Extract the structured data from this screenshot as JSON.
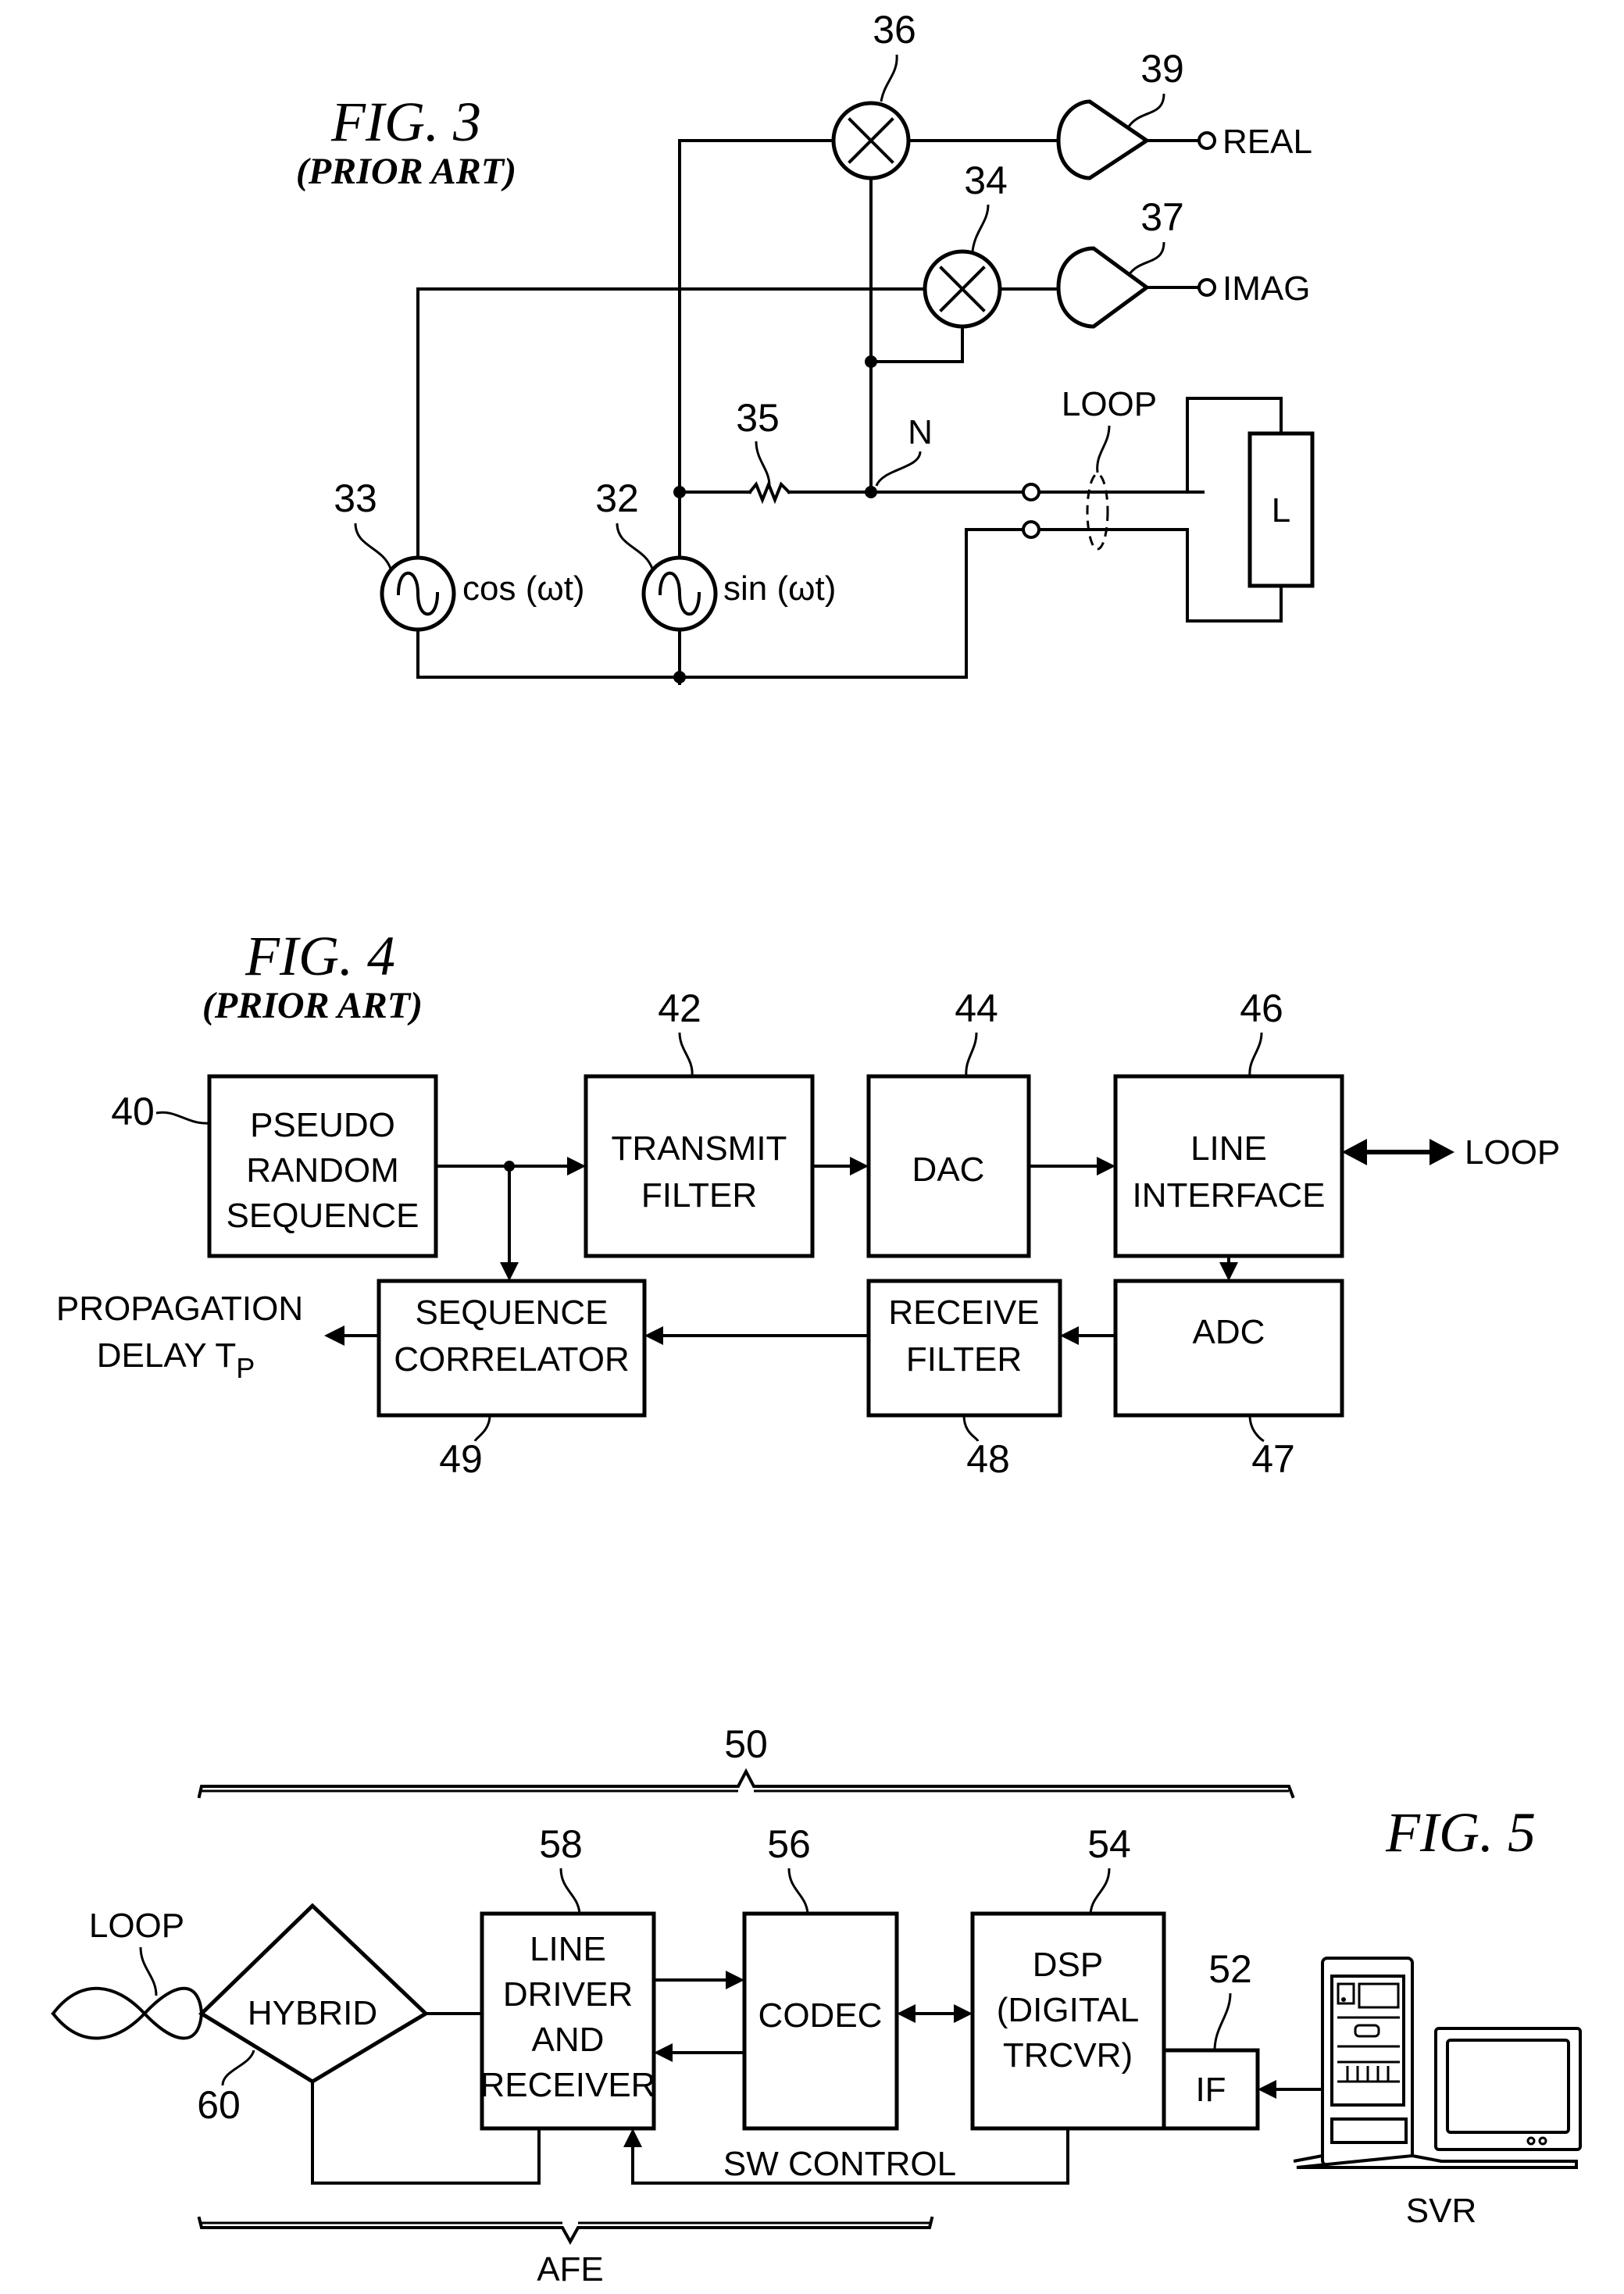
{
  "fig3": {
    "title": "FIG. 3",
    "subtitle": "(PRIOR ART)",
    "refs": {
      "r36": "36",
      "r39": "39",
      "r34": "34",
      "r37": "37",
      "r35": "35",
      "r33": "33",
      "r32": "32"
    },
    "outputs": {
      "real": "REAL",
      "imag": "IMAG"
    },
    "sources": {
      "cos": "cos (ωt)",
      "sin": "sin (ωt)"
    },
    "node": "N",
    "loop": "LOOP",
    "load": "L"
  },
  "fig4": {
    "title": "FIG. 4",
    "subtitle": "(PRIOR ART)",
    "blocks": {
      "prs": [
        "PSEUDO",
        "RANDOM",
        "SEQUENCE"
      ],
      "tx": [
        "TRANSMIT",
        "FILTER"
      ],
      "dac": [
        "DAC"
      ],
      "li": [
        "LINE",
        "INTERFACE"
      ],
      "adc": [
        "ADC"
      ],
      "rx": [
        "RECEIVE",
        "FILTER"
      ],
      "corr": [
        "SEQUENCE",
        "CORRELATOR"
      ]
    },
    "refs": {
      "r40": "40",
      "r42": "42",
      "r44": "44",
      "r46": "46",
      "r47": "47",
      "r48": "48",
      "r49": "49"
    },
    "loop": "LOOP",
    "output": [
      "PROPAGATION",
      "DELAY T",
      "P"
    ]
  },
  "fig5": {
    "title": "FIG. 5",
    "refs": {
      "r50": "50",
      "r58": "58",
      "r56": "56",
      "r54": "54",
      "r52": "52",
      "r60": "60"
    },
    "blocks": {
      "hybrid": [
        "HYBRID"
      ],
      "ldr": [
        "LINE",
        "DRIVER",
        "AND",
        "RECEIVER"
      ],
      "codec": [
        "CODEC"
      ],
      "dsp": [
        "DSP",
        "(DIGITAL",
        "TRCVR)"
      ],
      "if": [
        "IF"
      ]
    },
    "loop": "LOOP",
    "sw_control": "SW CONTROL",
    "afe": "AFE",
    "server": "SVR"
  }
}
